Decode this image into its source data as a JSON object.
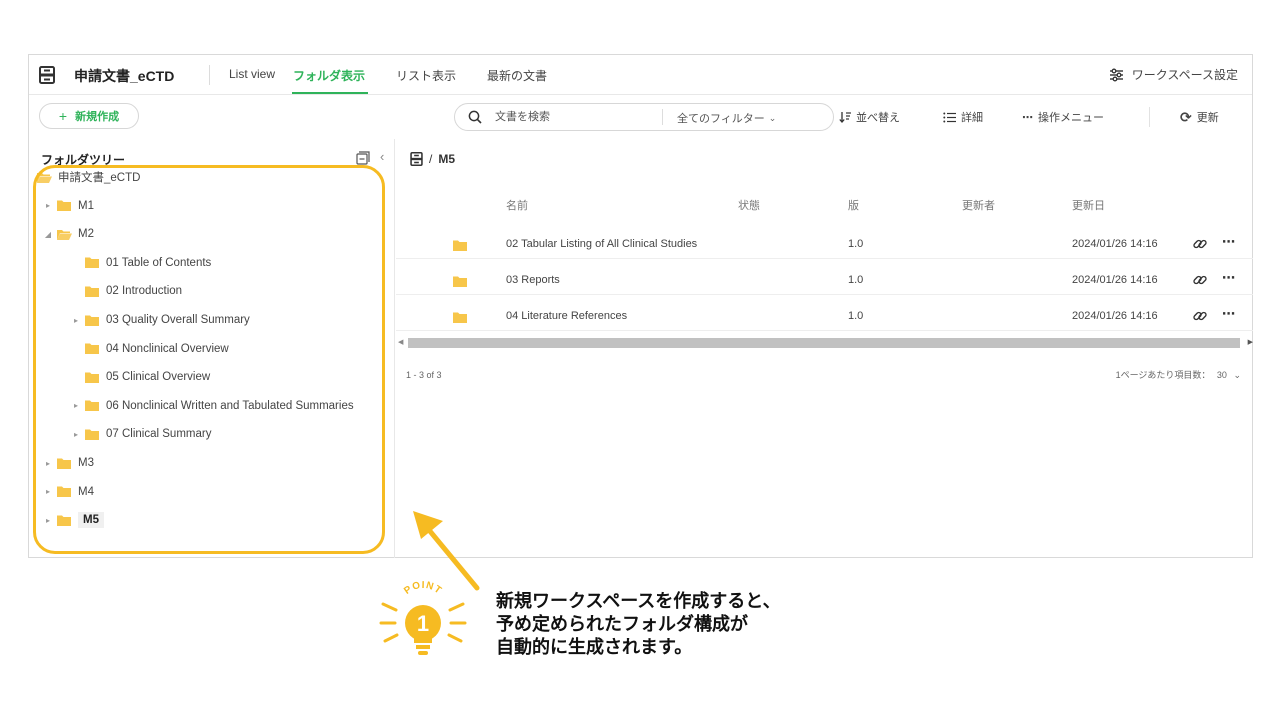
{
  "header": {
    "workspace_title": "申請文書_eCTD",
    "tabs": [
      {
        "label": "List view",
        "active": false
      },
      {
        "label": "フォルダ表示",
        "active": true
      },
      {
        "label": "リスト表示",
        "active": false
      },
      {
        "label": "最新の文書",
        "active": false
      }
    ],
    "settings_label": "ワークスペース設定"
  },
  "toolbar": {
    "new_label": "新規作成",
    "search_placeholder": "文書を検索",
    "filter_label": "全てのフィルター",
    "sort_label": "並べ替え",
    "detail_label": "詳細",
    "menu_label": "操作メニュー",
    "refresh_label": "更新"
  },
  "sidebar": {
    "title": "フォルダツリー",
    "tree": [
      {
        "label": "申請文書_eCTD",
        "level": 0,
        "expanded": true,
        "caret": false,
        "selected": false
      },
      {
        "label": "M1",
        "level": 1,
        "expanded": false,
        "caret": true,
        "selected": false
      },
      {
        "label": "M2",
        "level": 1,
        "expanded": true,
        "caret": true,
        "selected": false
      },
      {
        "label": "01 Table of Contents",
        "level": 2,
        "expanded": false,
        "caret": false,
        "selected": false
      },
      {
        "label": "02 Introduction",
        "level": 2,
        "expanded": false,
        "caret": false,
        "selected": false
      },
      {
        "label": "03 Quality Overall Summary",
        "level": 2,
        "expanded": false,
        "caret": true,
        "selected": false
      },
      {
        "label": "04 Nonclinical Overview",
        "level": 2,
        "expanded": false,
        "caret": false,
        "selected": false
      },
      {
        "label": "05 Clinical Overview",
        "level": 2,
        "expanded": false,
        "caret": false,
        "selected": false
      },
      {
        "label": "06 Nonclinical Written and Tabulated Summaries",
        "level": 2,
        "expanded": false,
        "caret": true,
        "selected": false
      },
      {
        "label": "07 Clinical Summary",
        "level": 2,
        "expanded": false,
        "caret": true,
        "selected": false
      },
      {
        "label": "M3",
        "level": 1,
        "expanded": false,
        "caret": true,
        "selected": false
      },
      {
        "label": "M4",
        "level": 1,
        "expanded": false,
        "caret": true,
        "selected": false
      },
      {
        "label": "M5",
        "level": 1,
        "expanded": false,
        "caret": true,
        "selected": true
      }
    ]
  },
  "main": {
    "breadcrumb_sep": "/",
    "breadcrumb_current": "M5",
    "columns": [
      "名前",
      "状態",
      "版",
      "更新者",
      "更新日"
    ],
    "rows": [
      {
        "name": "02 Tabular Listing of All Clinical Studies",
        "status": "",
        "version": "1.0",
        "updated_by": "",
        "updated_at": "2024/01/26 14:16"
      },
      {
        "name": "03 Reports",
        "status": "",
        "version": "1.0",
        "updated_by": "",
        "updated_at": "2024/01/26 14:16"
      },
      {
        "name": "04 Literature References",
        "status": "",
        "version": "1.0",
        "updated_by": "",
        "updated_at": "2024/01/26 14:16"
      }
    ],
    "pagination": "1 - 3 of 3",
    "per_page_label": "1ページあたり項目数：",
    "per_page_value": "30"
  },
  "annotation": {
    "badge_text": "POINT",
    "badge_number": "1",
    "lines": [
      "新規ワークスペースを作成すると、",
      "予め定められたフォルダ構成が",
      "自動的に生成されます。"
    ]
  },
  "colors": {
    "accent": "#2fb35a",
    "folder": "#f7c64a",
    "highlight": "#f6bb22",
    "arrow": "#f6bb22"
  }
}
